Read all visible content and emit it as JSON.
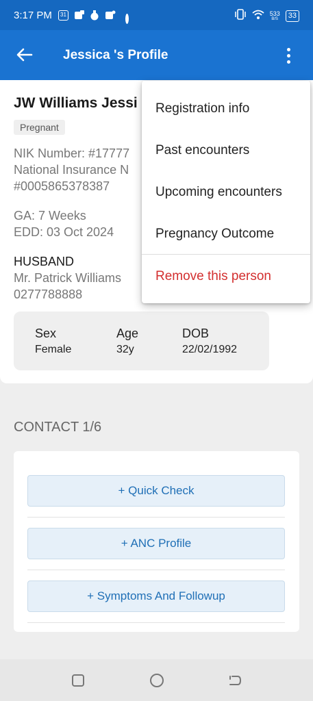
{
  "status_bar": {
    "time": "3:17 PM",
    "calendar_badge": "31",
    "network_speed_value": "533",
    "network_speed_unit": "B/S",
    "battery": "33"
  },
  "app_bar": {
    "title": "Jessica 's Profile",
    "back_icon": "arrow-left-icon",
    "more_icon": "more-vertical-icon"
  },
  "profile": {
    "name": "JW Williams Jessi",
    "status_badge": "Pregnant",
    "nik_line": "NIK Number: #17777",
    "insurance_line": "National Insurance N",
    "insurance_number": "#0005865378387",
    "ga": "GA: 7 Weeks",
    "edd": "EDD: 03 Oct 2024",
    "husband_label": "HUSBAND",
    "husband_name": "Mr. Patrick Williams",
    "husband_phone": "0277788888",
    "demographics": {
      "sex_label": "Sex",
      "sex_value": "Female",
      "age_label": "Age",
      "age_value": "32y",
      "dob_label": "DOB",
      "dob_value": "22/02/1992"
    }
  },
  "contact": {
    "title": "CONTACT 1/6",
    "buttons": [
      {
        "label": "+ Quick Check"
      },
      {
        "label": "+ ANC Profile"
      },
      {
        "label": "+ Symptoms And Followup"
      }
    ]
  },
  "menu": {
    "items": [
      {
        "label": "Registration info"
      },
      {
        "label": "Past encounters"
      },
      {
        "label": "Upcoming encounters"
      },
      {
        "label": "Pregnancy Outcome"
      }
    ],
    "remove_label": "Remove this person"
  },
  "colors": {
    "app_bar": "#1a73d1",
    "status_bar": "#1568c0",
    "button_text": "#1f6fb6",
    "danger": "#d32f2f"
  }
}
